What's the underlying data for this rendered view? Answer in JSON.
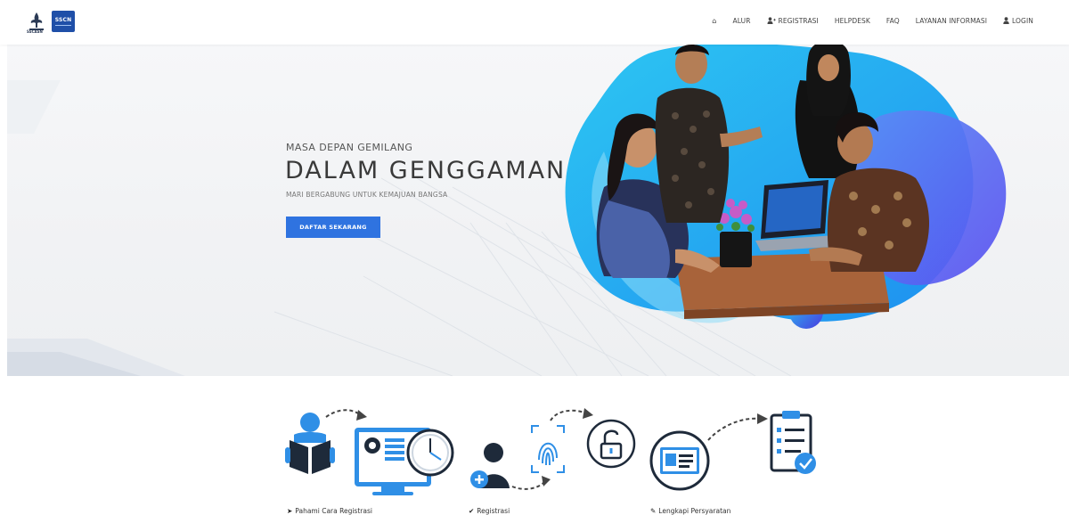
{
  "header": {
    "logo_small_text": "SSCASN",
    "logo_box_text": "SSCN"
  },
  "nav": [
    {
      "label": "",
      "icon": "home-icon"
    },
    {
      "label": "ALUR",
      "icon": ""
    },
    {
      "label": "REGISTRASI",
      "icon": "user-plus-icon"
    },
    {
      "label": "HELPDESK",
      "icon": ""
    },
    {
      "label": "FAQ",
      "icon": ""
    },
    {
      "label": "LAYANAN INFORMASI",
      "icon": ""
    },
    {
      "label": "LOGIN",
      "icon": "user-icon"
    }
  ],
  "hero": {
    "subtitle": "MASA DEPAN GEMILANG",
    "title": "DALAM GENGGAMAN",
    "tagline": "MARI BERGABUNG UNTUK KEMAJUAN BANGSA",
    "cta": "DAFTAR SEKARANG"
  },
  "steps": [
    {
      "label": "Pahami Cara Registrasi",
      "icon": "location-arrow-icon"
    },
    {
      "label": "Registrasi",
      "icon": "check-icon"
    },
    {
      "label": "Lengkapi Persyaratan",
      "icon": "wrench-icon"
    }
  ],
  "colors": {
    "accent": "#2f73e0",
    "icon_blue": "#2f8fe6",
    "dark": "#3a3a3a",
    "cyan": "#2dc6f2",
    "purple": "#5a4ff0"
  }
}
